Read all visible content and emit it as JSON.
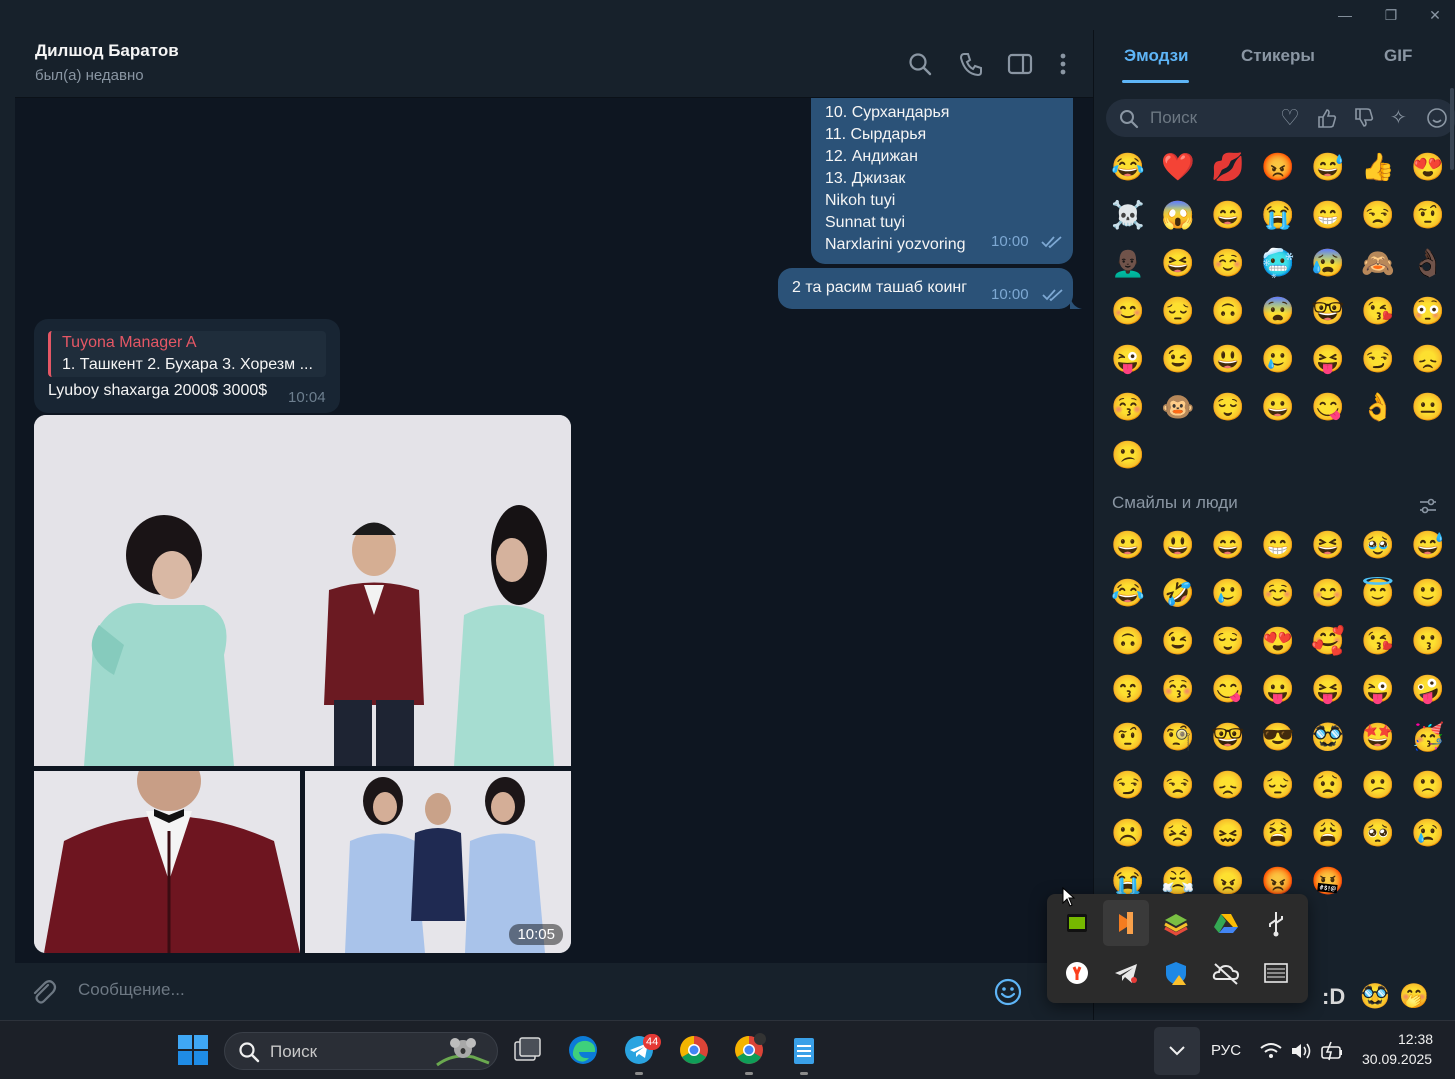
{
  "header": {
    "name": "Дилшод Баратов",
    "status": "был(а) недавно"
  },
  "messages": {
    "list_lines": [
      "10. Сурхандарья",
      "11. Сырдарья",
      "12. Андижан",
      "13. Джизак",
      "Nikoh tuyi",
      "Sunnat tuyi",
      "Narxlarini yozvoring"
    ],
    "list_time": "10:00",
    "photo_request": "2 та расим ташаб коинг",
    "photo_request_time": "10:00",
    "reply_name": "Tuyona Manager A",
    "reply_text": "1. Ташкент 2. Бухара 3. Хорезм ...",
    "reply_body": "Lyuboy shaxarga 2000$ 3000$",
    "reply_time": "10:04",
    "album_time": "10:05"
  },
  "composer": {
    "placeholder": "Сообщение..."
  },
  "emoji_panel": {
    "tabs": [
      "Эмодзи",
      "Стикеры",
      "GIF"
    ],
    "search_placeholder": "Поиск",
    "recent": [
      "😂",
      "❤️",
      "💋",
      "😡",
      "😅",
      "👍",
      "😍",
      "☠️",
      "😱",
      "😄",
      "😭",
      "😁",
      "😒",
      "🤨",
      "👨🏿‍🦲",
      "😆",
      "☺️",
      "🥶",
      "😰",
      "🙈",
      "👌🏿",
      "😊",
      "😔",
      "🙃",
      "😨",
      "🤓",
      "😘",
      "😳",
      "😜",
      "😉",
      "😃",
      "🥲",
      "😝",
      "😏",
      "😞",
      "😚",
      "🐵",
      "😌",
      "😀",
      "😋",
      "👌",
      "😐",
      "😕"
    ],
    "section_title": "Смайлы и люди",
    "people": [
      "😀",
      "😃",
      "😄",
      "😁",
      "😆",
      "🥹",
      "😅",
      "😂",
      "🤣",
      "🥲",
      "☺️",
      "😊",
      "😇",
      "🙂",
      "🙃",
      "😉",
      "😌",
      "😍",
      "🥰",
      "😘",
      "😗",
      "😙",
      "😚",
      "😋",
      "😛",
      "😝",
      "😜",
      "🤪",
      "🤨",
      "🧐",
      "🤓",
      "😎",
      "🥸",
      "🤩",
      "🥳",
      "😏",
      "😒",
      "😞",
      "😔",
      "😟",
      "😕",
      "🙁",
      "☹️",
      "😣",
      "😖",
      "😫",
      "😩",
      "🥺",
      "😢",
      "😭",
      "😤",
      "😠",
      "😡",
      "🤬"
    ]
  },
  "tray": {
    "icons": [
      "nvidia-icon",
      "vlc-icon",
      "bluestacks-icon",
      "google-drive-icon",
      "usb-icon",
      "yandex-icon",
      "telegram-icon",
      "defender-icon",
      "onedrive-icon",
      "keyboard-icon"
    ]
  },
  "taskbar": {
    "search_placeholder": "Поиск",
    "telegram_badge": "44",
    "language": "РУС",
    "time": "12:38",
    "date": "30.09.2025"
  },
  "colors": {
    "outgoing_bubble": "#2b5278",
    "incoming_bubble": "#182533",
    "accent": "#5eb5f7",
    "reply_accent": "#e55765"
  }
}
